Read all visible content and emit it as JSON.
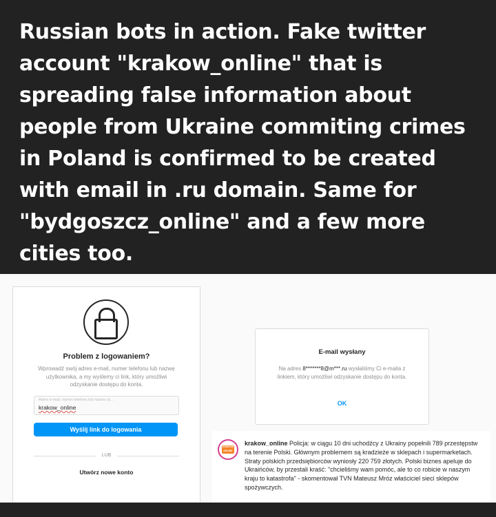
{
  "headline": "Russian bots in action. Fake twitter account \"krakow_online\" that is spreading false information about people from Ukraine commiting crimes in Poland is confirmed to be created with email in .ru domain. Same for \"bydgoszcz_online\" and a few more cities too.",
  "login": {
    "title": "Problem z logowaniem?",
    "description": "Wprowadź swój adres e-mail, numer telefonu lub nazwę użytkownika, a my wyślemy ci link, który umożliwi odzyskanie dostępu do konta.",
    "field_placeholder": "Adres e-mail, numer telefonu lub nazwa uż...",
    "field_value": "krakow_online",
    "button": "Wyślij link do logowania",
    "or": "LUB",
    "create_account": "Utwórz nowe konto",
    "icon": "lock-icon"
  },
  "dialog": {
    "title": "E-mail wysłany",
    "text_prefix": "Na adres",
    "email": "8*******8@m***.ru",
    "text_suffix": "wysłaliśmy Ci e-maila z linkiem, który umożliwi odzyskanie dostępu do konta.",
    "ok": "OK"
  },
  "post": {
    "avatar_text": "KRAKÓW ONLINE",
    "username": "krakow_online",
    "text": "Policja: w ciągu 10 dni uchodźcy z Ukrainy popełnili 789 przestępstw na terenie Polski. Głównym problemem są kradzieże w sklepach i supermarketach. Straty polskich przedsiębiorców wyniosły 220 759 złotych. Polski biznes apeluje do Ukraińców, by przestali kraść: \"chcieliśmy wam pomóc, ale to co robicie w naszym kraju to katastrofa\" - skomentował TVN Mateusz Mróz właściciel sieci sklepów spożywczych."
  },
  "colors": {
    "background": "#222222",
    "accent": "#0095f6",
    "avatar_ring": "#d33e8f"
  }
}
